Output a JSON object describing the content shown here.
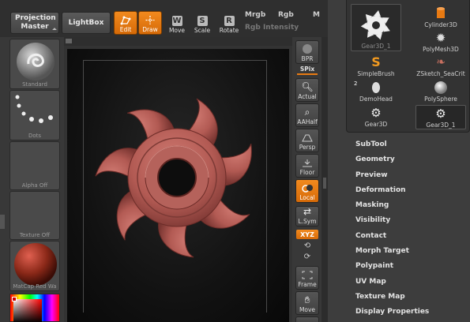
{
  "topbar": {
    "projection_master": "Projection Master",
    "lightbox": "LightBox",
    "tools": [
      {
        "label": "Edit",
        "icon": "edit-icon",
        "active": true
      },
      {
        "label": "Draw",
        "icon": "draw-icon",
        "active": true
      },
      {
        "label": "Move",
        "icon": "move-icon",
        "key": "W"
      },
      {
        "label": "Scale",
        "icon": "scale-icon",
        "key": "S"
      },
      {
        "label": "Rotate",
        "icon": "rotate-icon",
        "key": "R"
      }
    ],
    "mrgb": "Mrgb",
    "rgb": "Rgb",
    "m": "M",
    "rgb_intensity": "Rgb Intensity"
  },
  "left_shelf": {
    "slots": [
      {
        "label": "Standard",
        "icon": "standard-brush-icon"
      },
      {
        "label": "Dots",
        "icon": "dots-stroke-icon"
      },
      {
        "label": "Alpha Off",
        "icon": "alpha-icon"
      },
      {
        "label": "Texture Off",
        "icon": "texture-icon"
      },
      {
        "label": "MatCap Red Wa",
        "icon": "matcap-material-icon"
      }
    ]
  },
  "right_shelf": {
    "buttons": [
      {
        "label": "BPR",
        "icon": "bpr-icon"
      },
      {
        "label": "SPix",
        "is_text": true
      },
      {
        "label": "Actual",
        "icon": "actual-zoom-icon"
      },
      {
        "label": "AAHalf",
        "icon": "aahalf-icon"
      },
      {
        "label": "Persp",
        "icon": "perspective-icon"
      },
      {
        "label": "Floor",
        "icon": "floor-icon"
      },
      {
        "label": "Local",
        "icon": "local-icon",
        "active": true
      },
      {
        "label": "L.Sym",
        "icon": "lsym-icon"
      },
      {
        "label": "XYZ",
        "icon": "xyz-icon",
        "active": true
      },
      {
        "label": "Frame",
        "icon": "frame-icon"
      },
      {
        "label": "Move",
        "icon": "move-hand-icon"
      }
    ]
  },
  "tool_palette": {
    "items": [
      {
        "label": "Gear3D_1",
        "icon": "gear-icon"
      },
      {
        "label": "Cylinder3D",
        "icon": "cylinder-icon"
      },
      {
        "label": "PolyMesh3D",
        "icon": "polymesh-star-icon"
      },
      {
        "label": "SimpleBrush",
        "icon": "simplebrush-icon"
      },
      {
        "label": "ZSketch_SeaCrit",
        "icon": "zsketch-icon"
      },
      {
        "label": "DemoHead",
        "icon": "demohead-icon",
        "badge": "2"
      },
      {
        "label": "PolySphere",
        "icon": "sphere-icon"
      },
      {
        "label": "Gear3D",
        "icon": "gear-small-icon"
      },
      {
        "label": "Gear3D_1",
        "icon": "gear-small-icon"
      }
    ]
  },
  "menu": {
    "items": [
      "SubTool",
      "Geometry",
      "Preview",
      "Deformation",
      "Masking",
      "Visibility",
      "Contact",
      "Morph Target",
      "Polypaint",
      "UV Map",
      "Texture Map",
      "Display Properties"
    ]
  },
  "colors": {
    "accent_orange": "#e87a12",
    "gear_color": "#b85a55",
    "background": "#3a3a3a"
  }
}
